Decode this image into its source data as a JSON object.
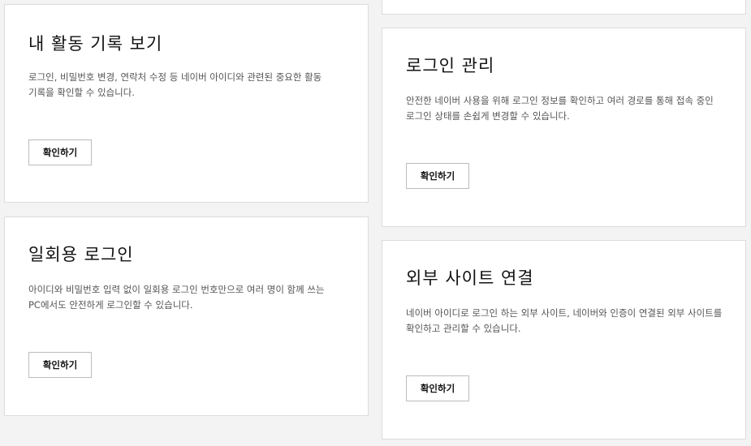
{
  "cards": [
    {
      "title": "내 활동 기록 보기",
      "description": "로그인, 비밀번호 변경, 연락처 수정 등 네이버 아이디와 관련된 중요한 활동 기록을 확인할 수 있습니다.",
      "button_label": "확인하기"
    },
    {
      "title": "로그인 관리",
      "description": "안전한 네이버 사용을 위해 로그인 정보를 확인하고 여러 경로를 통해 접속 중인 로그인 상태를 손쉽게 변경할 수 있습니다.",
      "button_label": "확인하기"
    },
    {
      "title": "일회용 로그인",
      "description": "아이디와 비밀번호 입력 없이 일회용 로그인 번호만으로 여러 명이 함께 쓰는 PC에서도 안전하게 로그인할 수 있습니다.",
      "button_label": "확인하기"
    },
    {
      "title": "외부 사이트 연결",
      "description": "네이버 아이디로 로그인 하는 외부 사이트, 네이버와 인증이 연결된 외부 사이트를 확인하고 관리할 수 있습니다.",
      "button_label": "확인하기"
    }
  ]
}
